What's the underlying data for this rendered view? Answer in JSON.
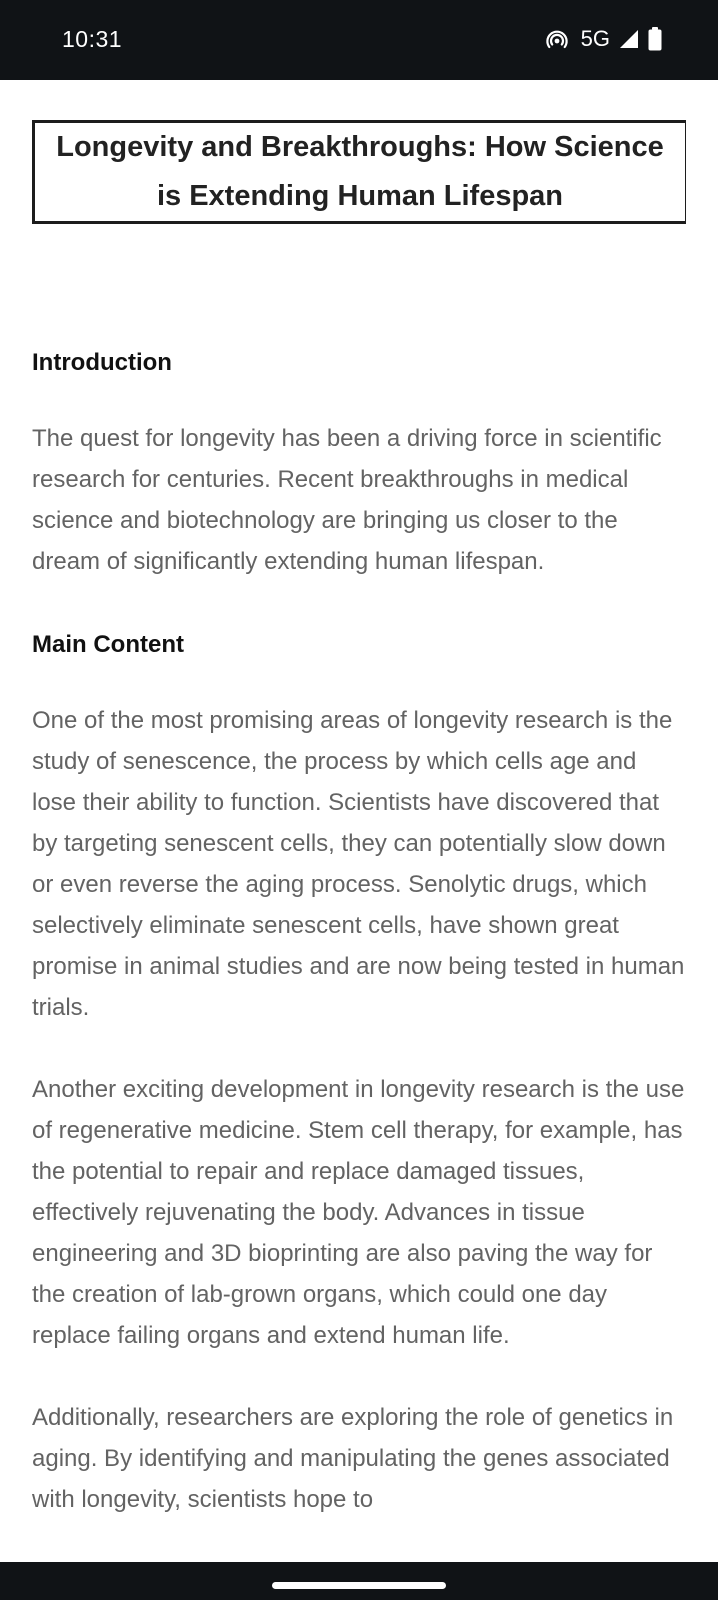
{
  "status_bar": {
    "time": "10:31",
    "network": "5G",
    "icons": [
      "hotspot-icon",
      "signal-icon",
      "battery-icon"
    ]
  },
  "article": {
    "title": "Longevity and Breakthroughs: How Science is Extending Human Lifespan",
    "sections": [
      {
        "heading": "Introduction",
        "paragraphs": [
          "The quest for longevity has been a driving force in scientific research for centuries. Recent breakthroughs in medical science and biotechnology are bringing us closer to the dream of significantly extending human lifespan."
        ]
      },
      {
        "heading": "Main Content",
        "paragraphs": [
          "One of the most promising areas of longevity research is the study of senescence, the process by which cells age and lose their ability to function. Scientists have discovered that by targeting senescent cells, they can potentially slow down or even reverse the aging process. Senolytic drugs, which selectively eliminate senescent cells, have shown great promise in animal studies and are now being tested in human trials.",
          "Another exciting development in longevity research is the use of regenerative medicine. Stem cell therapy, for example, has the potential to repair and replace damaged tissues, effectively rejuvenating the body. Advances in tissue engineering and 3D bioprinting are also paving the way for the creation of lab-grown organs, which could one day replace failing organs and extend human life.",
          "Additionally, researchers are exploring the role of genetics in aging. By identifying and manipulating the genes associated with longevity, scientists hope to"
        ]
      }
    ]
  },
  "colors": {
    "status_bar_bg": "#101316",
    "body_text": "#636363",
    "heading_text": "#111111",
    "title_border": "#1c1c1c"
  }
}
